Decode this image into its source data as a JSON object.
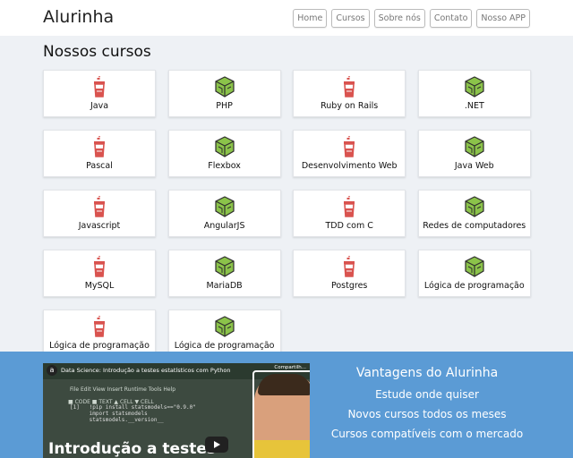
{
  "header": {
    "logo": "Alurinha",
    "nav": [
      "Home",
      "Cursos",
      "Sobre nós",
      "Contato",
      "Nosso APP"
    ]
  },
  "main": {
    "title": "Nossos cursos",
    "courses": [
      {
        "label": "Java",
        "icon": "flask-icon"
      },
      {
        "label": "PHP",
        "icon": "cube-icon"
      },
      {
        "label": "Ruby on Rails",
        "icon": "flask-icon"
      },
      {
        "label": ".NET",
        "icon": "cube-icon"
      },
      {
        "label": "Pascal",
        "icon": "flask-icon"
      },
      {
        "label": "Flexbox",
        "icon": "cube-icon"
      },
      {
        "label": "Desenvolvimento Web",
        "icon": "flask-icon"
      },
      {
        "label": "Java Web",
        "icon": "cube-icon"
      },
      {
        "label": "Javascript",
        "icon": "flask-icon"
      },
      {
        "label": "AngularJS",
        "icon": "cube-icon"
      },
      {
        "label": "TDD com C",
        "icon": "flask-icon"
      },
      {
        "label": "Redes de computadores",
        "icon": "cube-icon"
      },
      {
        "label": "MySQL",
        "icon": "flask-icon"
      },
      {
        "label": "MariaDB",
        "icon": "cube-icon"
      },
      {
        "label": "Postgres",
        "icon": "flask-icon"
      },
      {
        "label": "Lógica de programação",
        "icon": "cube-icon"
      },
      {
        "label": "Lógica de programação",
        "icon": "flask-icon"
      },
      {
        "label": "Lógica de programação",
        "icon": "cube-icon"
      }
    ]
  },
  "footer": {
    "video": {
      "channel": "a",
      "title": "Data Science: Introdução a testes estatísticos com Python",
      "menu": "File   Edit   View   Insert   Runtime   Tools   Help",
      "toolbar": "■ CODE   ■ TEXT   ▲ CELL   ▼ CELL",
      "code": "[1]   !pip install statsmodels==\"0.9.0\"\n      import statsmodels\n      statsmodels.__version__",
      "big_title": "Introdução a testes",
      "share": "Compartilh..."
    },
    "advantages": {
      "heading": "Vantagens do Alurinha",
      "items": [
        "Estude onde quiser",
        "Novos cursos todos os meses",
        "Cursos compatíveis com o mercado"
      ]
    }
  },
  "colors": {
    "main_bg": "#eef1f5",
    "footer_bg": "#5b9bd5",
    "flask_red": "#d9534f",
    "cube_green": "#8bc34a"
  }
}
